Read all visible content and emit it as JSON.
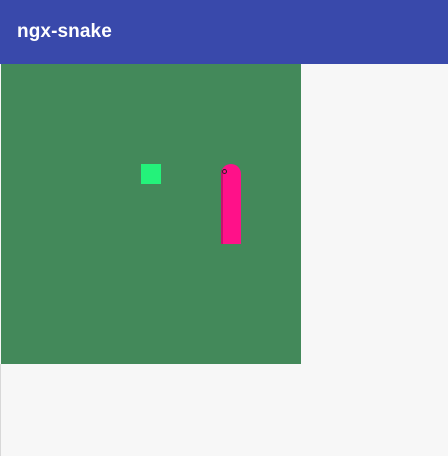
{
  "toolbar": {
    "title": "ngx-snake",
    "color": "#3949ab"
  },
  "board": {
    "background_color": "#43895a"
  },
  "food": {
    "color": "#24f27a"
  },
  "snake": {
    "color": "#ff1189",
    "direction": "up",
    "length_segments": 4
  }
}
